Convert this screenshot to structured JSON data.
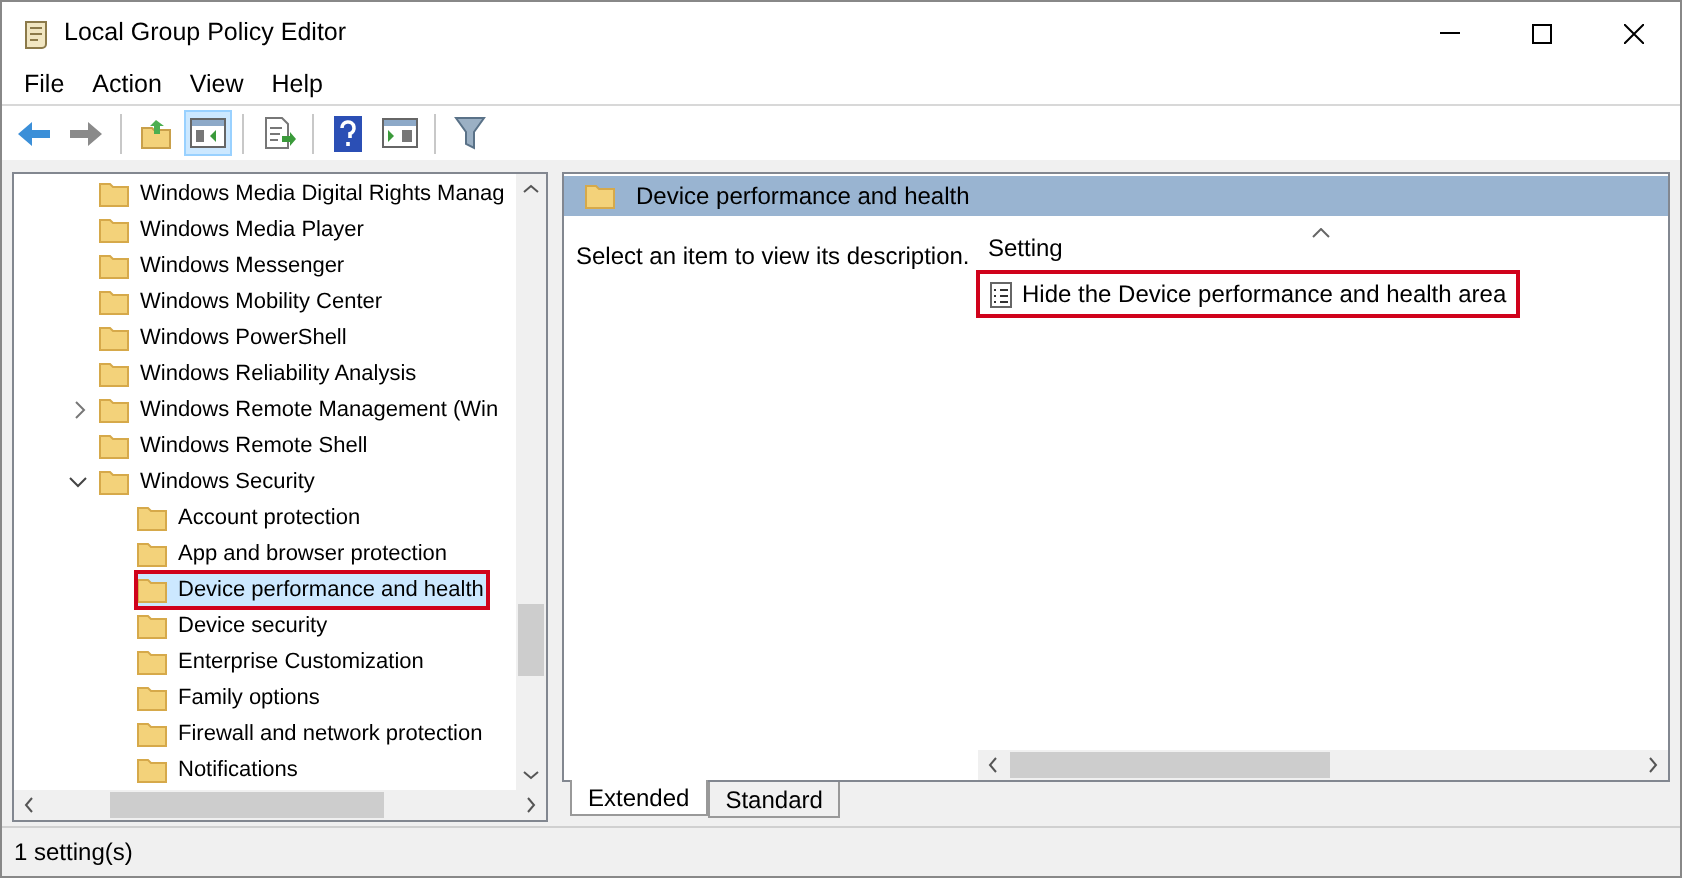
{
  "window": {
    "title": "Local Group Policy Editor"
  },
  "menu": [
    "File",
    "Action",
    "View",
    "Help"
  ],
  "toolbar": [
    {
      "kind": "back",
      "selected": false
    },
    {
      "kind": "forward",
      "selected": false
    },
    {
      "kind": "up",
      "selected": false
    },
    {
      "kind": "tree",
      "selected": true
    },
    {
      "kind": "export",
      "selected": false
    },
    {
      "kind": "help",
      "selected": false
    },
    {
      "kind": "pane",
      "selected": false
    },
    {
      "kind": "filter",
      "selected": false
    }
  ],
  "tree": [
    {
      "label": "Windows Media Digital Rights Manag",
      "selected": false,
      "highlighted": false
    },
    {
      "label": "Windows Media Player",
      "selected": false,
      "highlighted": false
    },
    {
      "label": "Windows Messenger",
      "selected": false,
      "highlighted": false
    },
    {
      "label": "Windows Mobility Center",
      "selected": false,
      "highlighted": false
    },
    {
      "label": "Windows PowerShell",
      "selected": false,
      "highlighted": false
    },
    {
      "label": "Windows Reliability Analysis",
      "selected": false,
      "highlighted": false
    },
    {
      "label": "Windows Remote Management (Win",
      "expanded": false,
      "selected": false,
      "highlighted": false
    },
    {
      "label": "Windows Remote Shell",
      "selected": false,
      "highlighted": false
    },
    {
      "label": "Windows Security",
      "expanded": true,
      "selected": false,
      "highlighted": false,
      "children": [
        {
          "label": "Account protection",
          "selected": false,
          "highlighted": false
        },
        {
          "label": "App and browser protection",
          "selected": false,
          "highlighted": false
        },
        {
          "label": "Device performance and health",
          "selected": true,
          "highlighted": true
        },
        {
          "label": "Device security",
          "selected": false,
          "highlighted": false
        },
        {
          "label": "Enterprise Customization",
          "selected": false,
          "highlighted": false
        },
        {
          "label": "Family options",
          "selected": false,
          "highlighted": false
        },
        {
          "label": "Firewall and network protection",
          "selected": false,
          "highlighted": false
        },
        {
          "label": "Notifications",
          "selected": false,
          "highlighted": false
        }
      ]
    }
  ],
  "details": {
    "header": "Device performance and health",
    "description": "Select an item to view its description.",
    "column": "Setting",
    "settings": [
      {
        "label": "Hide the Device performance and health area",
        "highlighted": true
      }
    ]
  },
  "tabs": [
    {
      "label": "Extended",
      "selected": true
    },
    {
      "label": "Standard",
      "selected": false
    }
  ],
  "status_bar": "1 setting(s)"
}
